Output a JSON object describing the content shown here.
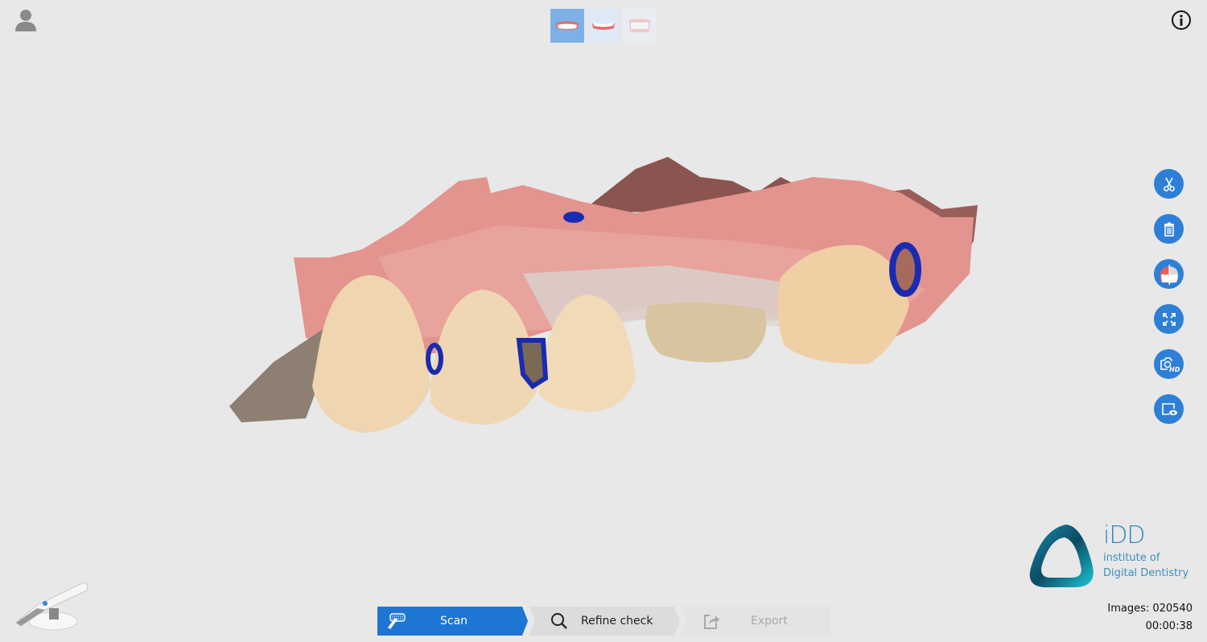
{
  "header": {
    "user_icon": "user-avatar-icon",
    "info_icon": "info-icon",
    "jaw_tabs": [
      {
        "name": "upper-jaw",
        "label": "Upper jaw",
        "active": true
      },
      {
        "name": "lower-jaw",
        "label": "Lower jaw",
        "active": false
      },
      {
        "name": "bite",
        "label": "Bite",
        "active": false
      }
    ]
  },
  "toolbar": {
    "tools": [
      {
        "icon": "scissors-icon",
        "label": "Cut"
      },
      {
        "icon": "trash-icon",
        "label": "Delete"
      },
      {
        "icon": "texture-toggle-icon",
        "label": "Color / mono view"
      },
      {
        "icon": "fit-screen-icon",
        "label": "Fit to screen"
      },
      {
        "icon": "hd-camera-icon",
        "label": "HD photo"
      },
      {
        "icon": "preview-eye-icon",
        "label": "Preview"
      }
    ],
    "accent": "#2e7fd6"
  },
  "logo": {
    "title": "iDD",
    "line1": "institute of",
    "line2": "Digital Dentistry"
  },
  "status": {
    "images_label": "Images: 020540",
    "timer": "00:00:38"
  },
  "steps": [
    {
      "label": "Scan",
      "icon": "scan-icon",
      "state": "active",
      "color": "#1e75d3"
    },
    {
      "label": "Refine check",
      "icon": "search-icon",
      "state": "available"
    },
    {
      "label": "Export",
      "icon": "export-icon",
      "state": "disabled"
    }
  ],
  "viewport": {
    "model": "3D intraoral scan of upper jaw",
    "scanner_icon": "intraoral-scanner-icon"
  }
}
